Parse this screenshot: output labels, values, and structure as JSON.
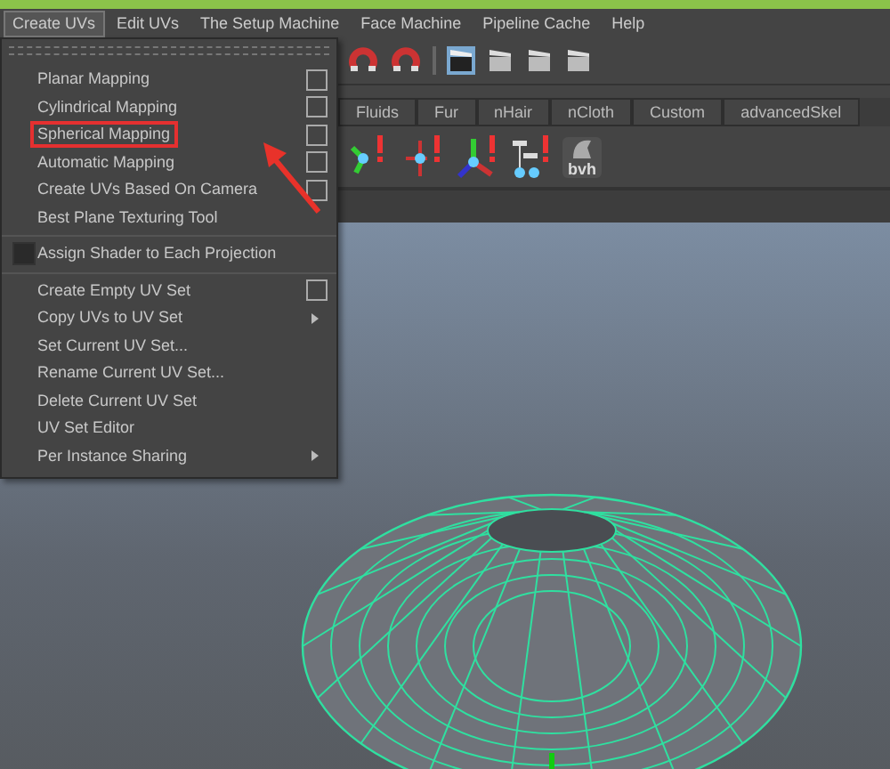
{
  "menubar": [
    {
      "label": "Create UVs",
      "selected": true
    },
    {
      "label": "Edit UVs",
      "selected": false
    },
    {
      "label": "The Setup Machine",
      "selected": false
    },
    {
      "label": "Face Machine",
      "selected": false
    },
    {
      "label": "Pipeline Cache",
      "selected": false
    },
    {
      "label": "Help",
      "selected": false
    }
  ],
  "shelf_tabs": [
    {
      "label": "Fluids",
      "selected": false
    },
    {
      "label": "Fur",
      "selected": false
    },
    {
      "label": "nHair",
      "selected": false
    },
    {
      "label": "nCloth",
      "selected": false
    },
    {
      "label": "Custom",
      "selected": false
    },
    {
      "label": "advancedSkel",
      "selected": false
    }
  ],
  "shelf_icon_label": "bvh",
  "menu": {
    "items": [
      {
        "kind": "item",
        "label": "Planar Mapping",
        "option_box": true,
        "submenu": false,
        "outlined": false
      },
      {
        "kind": "item",
        "label": "Cylindrical Mapping",
        "option_box": true,
        "submenu": false,
        "outlined": false
      },
      {
        "kind": "item",
        "label": "Spherical Mapping",
        "option_box": true,
        "submenu": false,
        "outlined": true
      },
      {
        "kind": "item",
        "label": "Automatic Mapping",
        "option_box": true,
        "submenu": false,
        "outlined": false
      },
      {
        "kind": "item",
        "label": "Create UVs Based On Camera",
        "option_box": true,
        "submenu": false,
        "outlined": false
      },
      {
        "kind": "item",
        "label": "Best Plane Texturing Tool",
        "option_box": false,
        "submenu": false,
        "outlined": false
      },
      {
        "kind": "divider"
      },
      {
        "kind": "checkbox",
        "label": "Assign Shader to Each Projection",
        "checked": false
      },
      {
        "kind": "divider"
      },
      {
        "kind": "item",
        "label": "Create Empty UV Set",
        "option_box": true,
        "submenu": false,
        "outlined": false
      },
      {
        "kind": "item",
        "label": "Copy UVs to UV Set",
        "option_box": false,
        "submenu": true,
        "outlined": false
      },
      {
        "kind": "item",
        "label": "Set Current UV Set...",
        "option_box": false,
        "submenu": false,
        "outlined": false
      },
      {
        "kind": "item",
        "label": "Rename Current UV Set...",
        "option_box": false,
        "submenu": false,
        "outlined": false
      },
      {
        "kind": "item",
        "label": "Delete Current UV Set",
        "option_box": false,
        "submenu": false,
        "outlined": false
      },
      {
        "kind": "item",
        "label": "UV Set Editor",
        "option_box": false,
        "submenu": false,
        "outlined": false
      },
      {
        "kind": "item",
        "label": "Per Instance Sharing",
        "option_box": false,
        "submenu": true,
        "outlined": false
      }
    ]
  }
}
